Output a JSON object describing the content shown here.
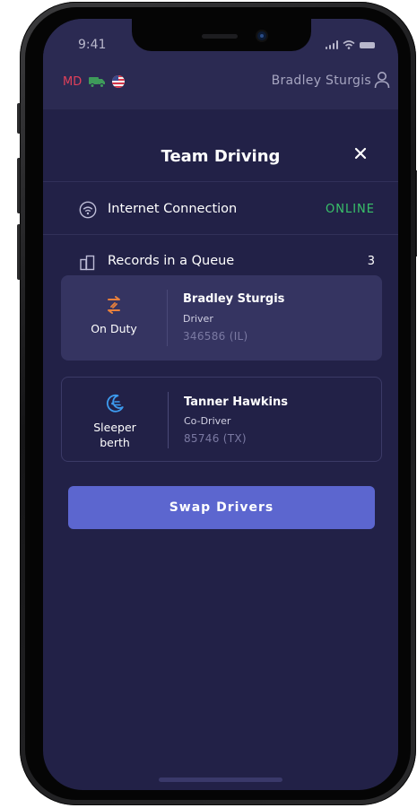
{
  "status_bar": {
    "time": "9:41"
  },
  "header": {
    "status_code": "MD",
    "user_name": "Bradley Sturgis",
    "icons": [
      "truck-icon",
      "us-flag-icon",
      "user-icon"
    ]
  },
  "modal": {
    "title": "Team Driving",
    "close_icon": "close-icon"
  },
  "rows": {
    "internet": {
      "label": "Internet Connection",
      "value": "ONLINE",
      "icon": "wifi-icon"
    },
    "queue": {
      "label": "Records in a Queue",
      "value": "3",
      "icon": "records-icon"
    }
  },
  "drivers": [
    {
      "status": "On Duty",
      "status_icon": "on-duty-icon",
      "name": "Bradley Sturgis",
      "role": "Driver",
      "license": "346586 (IL)",
      "active": true
    },
    {
      "status": "Sleeper berth",
      "status_icon": "sleeper-berth-icon",
      "name": "Tanner Hawkins",
      "role": "Co-Driver",
      "license": "85746 (TX)",
      "active": false
    }
  ],
  "actions": {
    "swap_label": "Swap Drivers"
  },
  "colors": {
    "background": "#222147",
    "header": "#2b2a52",
    "online": "#39c26a",
    "on_duty": "#e8803c",
    "sleeper": "#3d9bef",
    "button": "#5c66cf",
    "status_code": "#e0405a"
  }
}
